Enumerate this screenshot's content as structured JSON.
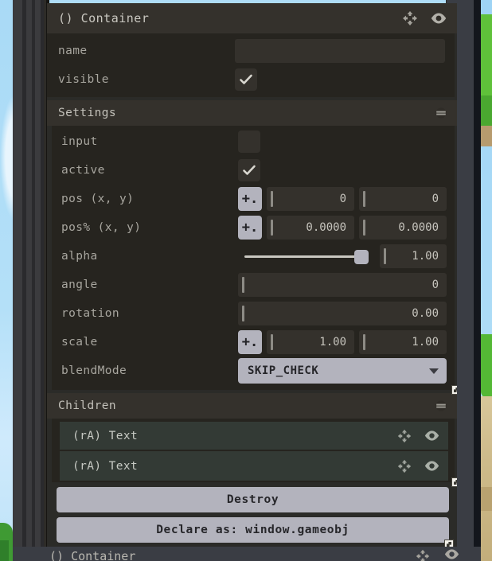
{
  "object": {
    "header_title": "() Container",
    "icons": {
      "move": "move-arrows-icon",
      "visibility": "eye-icon"
    },
    "fields": [
      {
        "label": "name",
        "type": "text",
        "value": ""
      },
      {
        "label": "visible",
        "type": "checkbox",
        "checked": true
      }
    ]
  },
  "settings": {
    "title": "Settings",
    "collapse_icon": "collapse-icon",
    "rows": {
      "input": {
        "label": "input",
        "checked": false
      },
      "active": {
        "label": "active",
        "checked": true
      },
      "pos": {
        "label": "pos (x, y)",
        "x": "0",
        "y": "0",
        "button": "+."
      },
      "pos_pct": {
        "label": "pos% (x, y)",
        "x": "0.0000",
        "y": "0.0000",
        "button": "+."
      },
      "alpha": {
        "label": "alpha",
        "value": "1.00",
        "slider_pct": 100
      },
      "angle": {
        "label": "angle",
        "value": "0"
      },
      "rotation": {
        "label": "rotation",
        "value": "0.00"
      },
      "scale": {
        "label": "scale",
        "x": "1.00",
        "y": "1.00",
        "button": "+."
      },
      "blendMode": {
        "label": "blendMode",
        "value": "SKIP_CHECK"
      }
    }
  },
  "children": {
    "title": "Children",
    "collapse_icon": "collapse-icon",
    "items": [
      {
        "label": "(rA) Text"
      },
      {
        "label": "(rA) Text"
      }
    ]
  },
  "actions": {
    "destroy": "Destroy",
    "declare": "Declare as: window.gameobj"
  },
  "next_object": {
    "header_title": "() Container"
  },
  "colors": {
    "panel_bg": "#2b2b28",
    "header_bg": "#34312c",
    "body_bg": "#26241f",
    "control_light": "#b3b3bd",
    "text": "#c9c7c0",
    "child_row_bg": "#333a35",
    "sky": "#aedcf7",
    "foliage": "#5fc13a"
  }
}
